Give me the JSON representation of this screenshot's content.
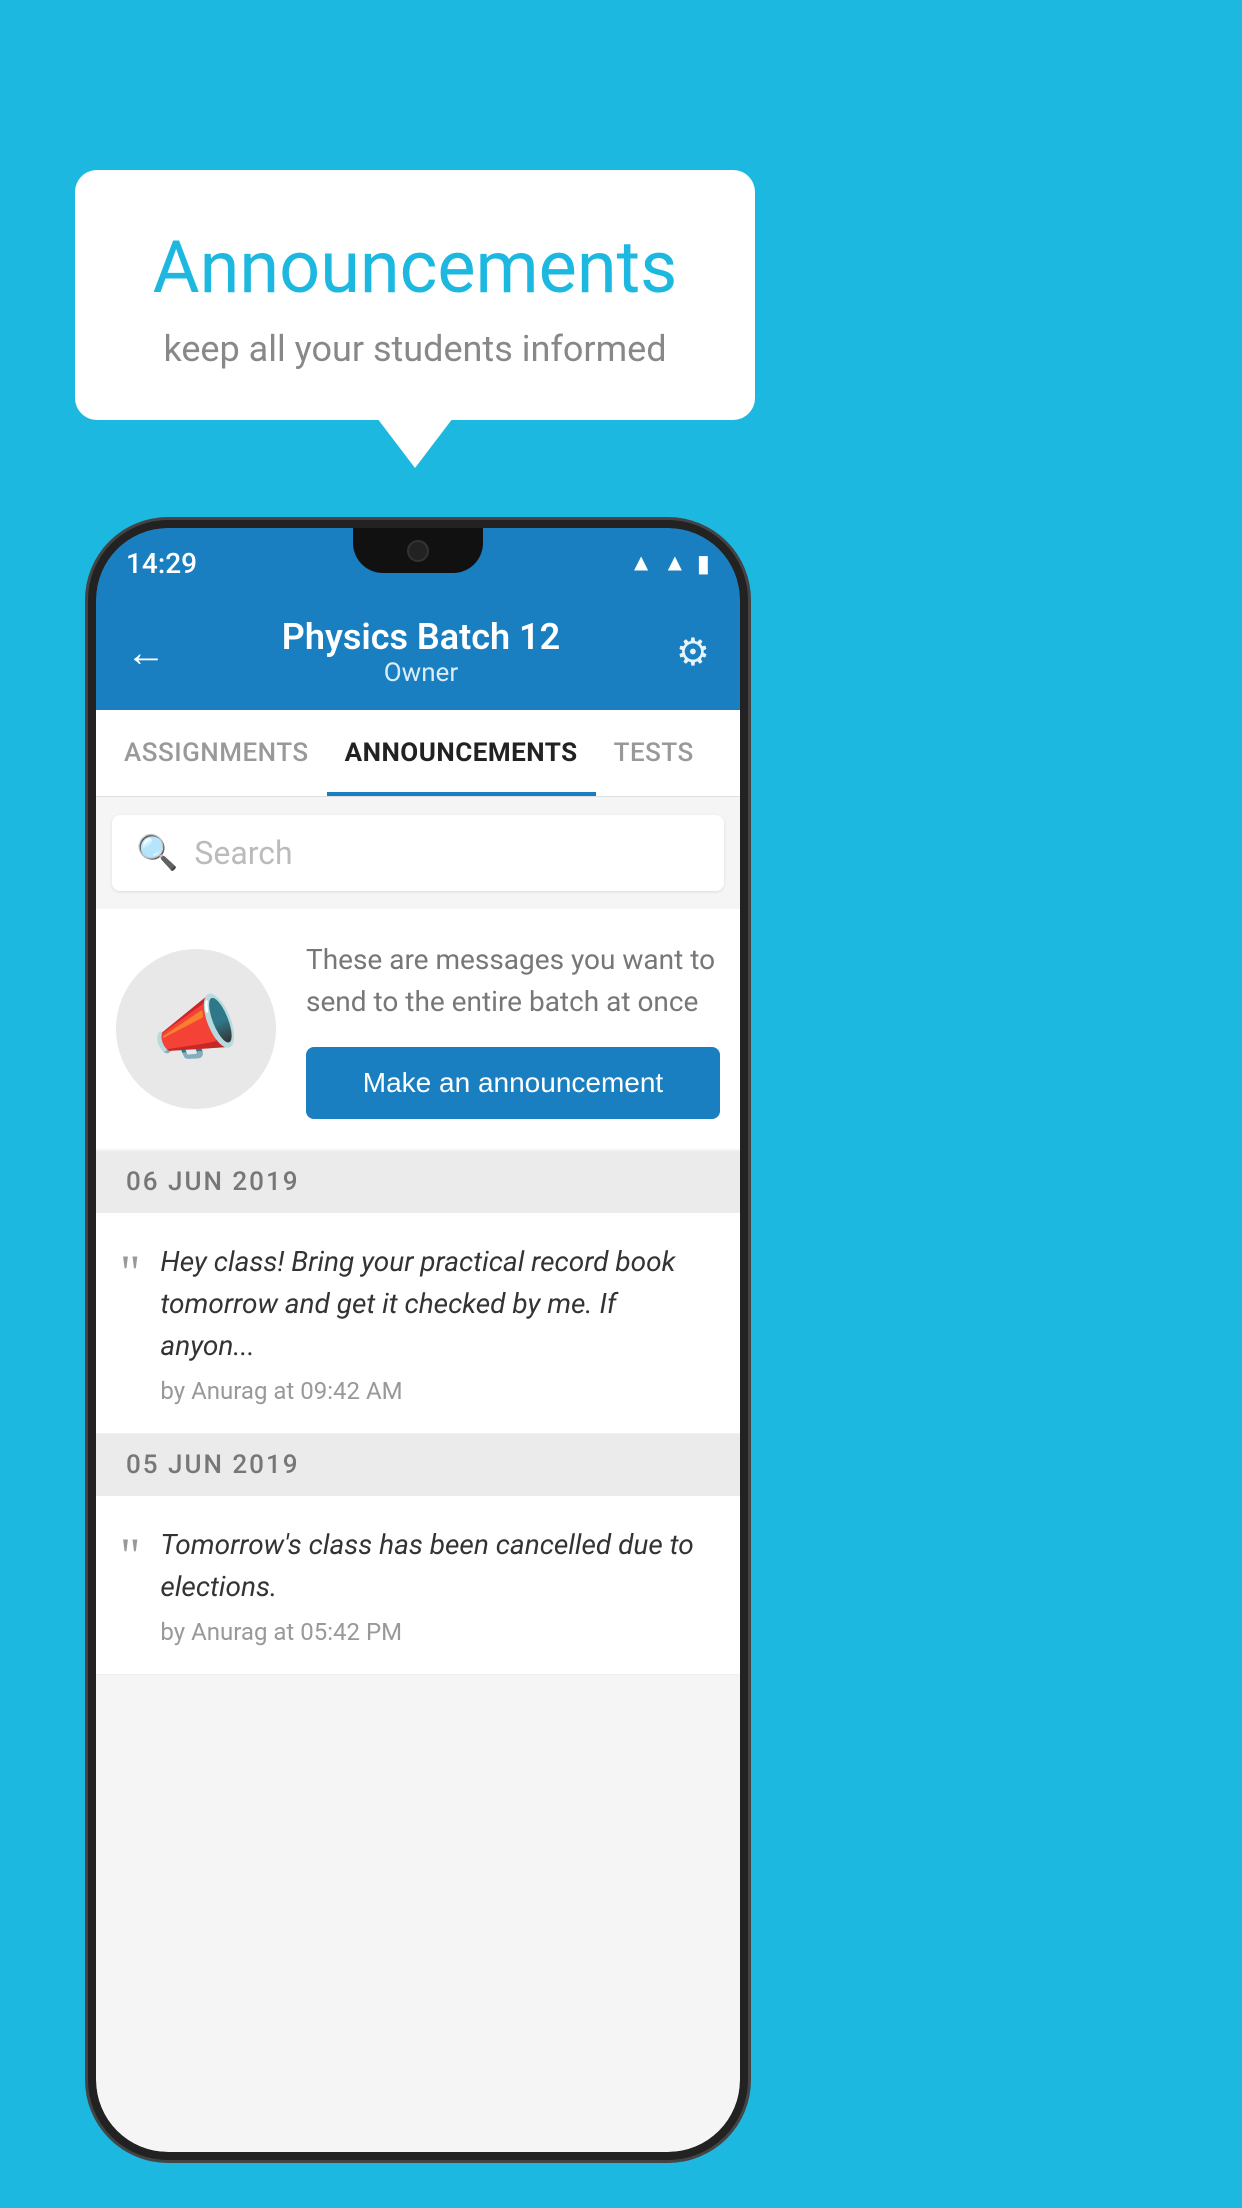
{
  "background_color": "#1cb8e0",
  "header_card": {
    "title": "Announcements",
    "subtitle": "keep all your students informed"
  },
  "phone": {
    "status_bar": {
      "time": "14:29",
      "icons": [
        "wifi",
        "signal",
        "battery"
      ]
    },
    "app_header": {
      "title": "Physics Batch 12",
      "subtitle": "Owner",
      "back_label": "←",
      "gear_label": "⚙"
    },
    "tabs": [
      {
        "label": "ASSIGNMENTS",
        "active": false
      },
      {
        "label": "ANNOUNCEMENTS",
        "active": true
      },
      {
        "label": "TESTS",
        "active": false
      }
    ],
    "search": {
      "placeholder": "Search"
    },
    "empty_state": {
      "description": "These are messages you want to send to the entire batch at once",
      "button_label": "Make an announcement"
    },
    "announcements": [
      {
        "date": "06  JUN  2019",
        "text": "Hey class! Bring your practical record book tomorrow and get it checked by me. If anyon...",
        "meta": "by Anurag at 09:42 AM"
      },
      {
        "date": "05  JUN  2019",
        "text": "Tomorrow's class has been cancelled due to elections.",
        "meta": "by Anurag at 05:42 PM"
      }
    ]
  }
}
